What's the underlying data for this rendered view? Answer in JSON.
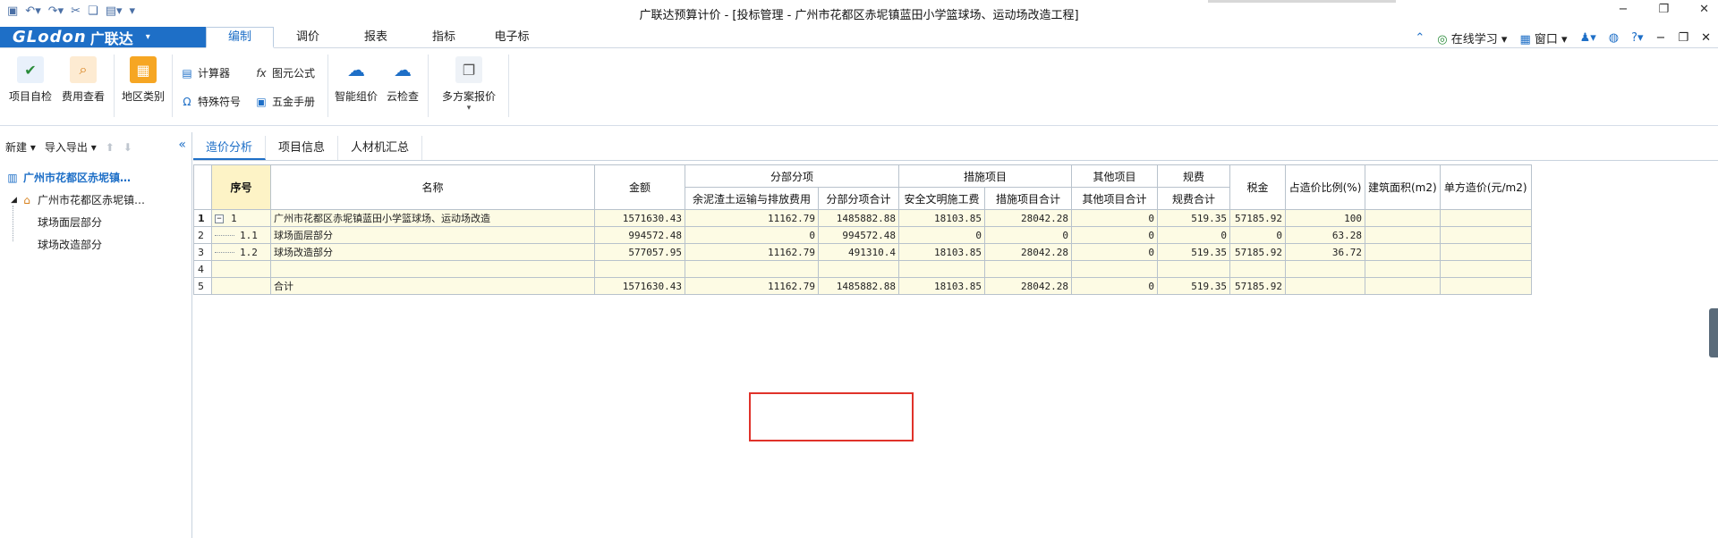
{
  "window": {
    "title": "广联达预算计价 - [投标管理 - 广州市花都区赤坭镇蓝田小学篮球场、运动场改造工程]",
    "controls": [
      "−",
      "❐",
      "✕"
    ]
  },
  "logo": {
    "en": "GLodon",
    "cn": "广联达",
    "drop": "▾"
  },
  "menu": {
    "tabs": [
      "编制",
      "调价",
      "报表",
      "指标",
      "电子标"
    ],
    "right": {
      "online_learning": "在线学习",
      "window": "窗口"
    }
  },
  "ribbon": {
    "buttons": [
      "项目自检",
      "费用查看",
      "地区类别",
      "智能组价",
      "云检查",
      "多方案报价"
    ],
    "small": [
      "计算器",
      "图元公式",
      "特殊符号",
      "五金手册"
    ]
  },
  "left_panel": {
    "toolbar": {
      "new": "新建",
      "import_export": "导入导出"
    },
    "tree": {
      "root": "广州市花都区赤坭镇…",
      "child": "广州市花都区赤坭镇…",
      "leaves": [
        "球场面层部分",
        "球场改造部分"
      ]
    }
  },
  "content_tabs": [
    "造价分析",
    "项目信息",
    "人材机汇总"
  ],
  "grid": {
    "headers": {
      "seq": "序号",
      "name": "名称",
      "amount": "金额",
      "fbfx": "分部分项",
      "fbfx_sub1": "余泥渣土运输与排放费用",
      "fbfx_sub2": "分部分项合计",
      "csxm": "措施项目",
      "csxm_sub1": "安全文明施工费",
      "csxm_sub2": "措施项目合计",
      "qtxm": "其他项目",
      "qtxm_sub1": "其他项目合计",
      "gf": "规费",
      "gf_sub1": "规费合计",
      "tax": "税金",
      "ratio": "占造价比例(%)",
      "area": "建筑面积(m2)",
      "unit_price": "单方造价(元/m2)"
    },
    "rows": [
      {
        "rownum": "1",
        "seq": "1",
        "expander": "−",
        "name": "广州市花都区赤坭镇蓝田小学篮球场、运动场改造",
        "amount": "1571630.43",
        "ynzt": "11162.79",
        "fbfx": "1485882.88",
        "aqwm": "18103.85",
        "csxm": "28042.28",
        "qtxm": "0",
        "gf": "519.35",
        "tax": "57185.92",
        "ratio": "100",
        "area": "",
        "unit": ""
      },
      {
        "rownum": "2",
        "seq": "1.1",
        "expander": "",
        "name": "球场面层部分",
        "amount": "994572.48",
        "ynzt": "0",
        "fbfx": "994572.48",
        "aqwm": "0",
        "csxm": "0",
        "qtxm": "0",
        "gf": "0",
        "tax": "0",
        "ratio": "63.28",
        "area": "",
        "unit": ""
      },
      {
        "rownum": "3",
        "seq": "1.2",
        "expander": "",
        "name": "球场改造部分",
        "amount": "577057.95",
        "ynzt": "11162.79",
        "fbfx": "491310.4",
        "aqwm": "18103.85",
        "csxm": "28042.28",
        "qtxm": "0",
        "gf": "519.35",
        "tax": "57185.92",
        "ratio": "36.72",
        "area": "",
        "unit": ""
      },
      {
        "rownum": "4",
        "seq": "",
        "expander": "",
        "name": "",
        "amount": "",
        "ynzt": "",
        "fbfx": "",
        "aqwm": "",
        "csxm": "",
        "qtxm": "",
        "gf": "",
        "tax": "",
        "ratio": "",
        "area": "",
        "unit": ""
      },
      {
        "rownum": "5",
        "seq": "",
        "expander": "",
        "name": "合计",
        "amount": "1571630.43",
        "ynzt": "11162.79",
        "fbfx": "1485882.88",
        "aqwm": "18103.85",
        "csxm": "28042.28",
        "qtxm": "0",
        "gf": "519.35",
        "tax": "57185.92",
        "ratio": "",
        "area": "",
        "unit": ""
      }
    ]
  },
  "colors": {
    "accent": "#1e6fc7",
    "row_bg": "#fdfbe4",
    "highlight_box": "#e0322a"
  }
}
